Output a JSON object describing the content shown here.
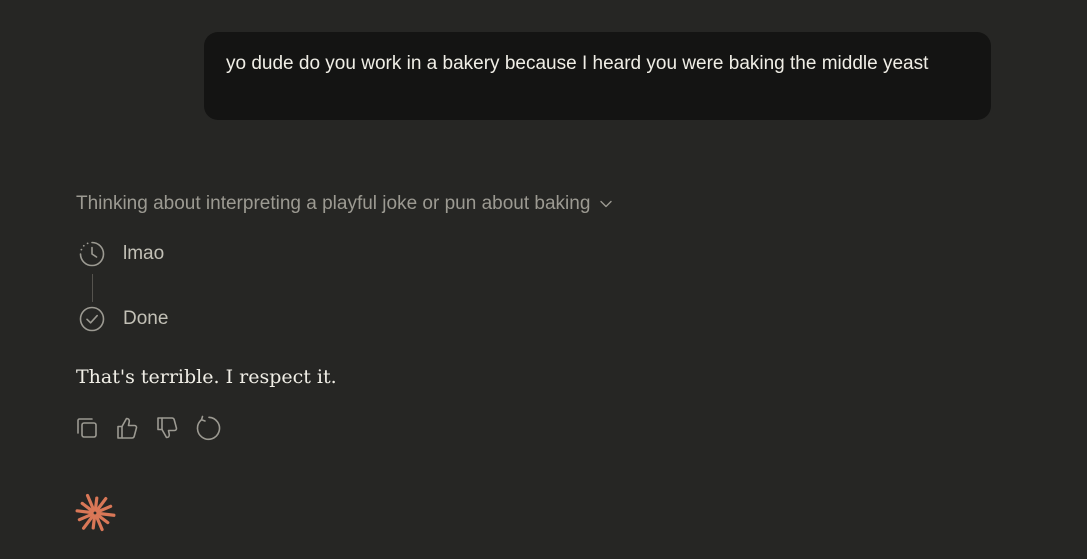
{
  "user_message": {
    "text": "yo dude do you work in a bakery because I heard you were baking the middle yeast"
  },
  "thinking": {
    "summary": "Thinking about interpreting a playful joke or pun about baking",
    "toggle_icon": "chevron-down-icon",
    "steps": [
      {
        "icon": "clock-icon",
        "label": "lmao"
      },
      {
        "icon": "check-circle-icon",
        "label": "Done"
      }
    ]
  },
  "assistant_message": {
    "text": "That's terrible. I respect it."
  },
  "actions": [
    {
      "icon": "copy-icon"
    },
    {
      "icon": "thumbs-up-icon"
    },
    {
      "icon": "thumbs-down-icon"
    },
    {
      "icon": "retry-icon"
    }
  ],
  "colors": {
    "background": "#262624",
    "user_bubble": "#141413",
    "text_primary": "#f0eee6",
    "text_muted": "#9c9a92",
    "accent": "#d97757"
  }
}
